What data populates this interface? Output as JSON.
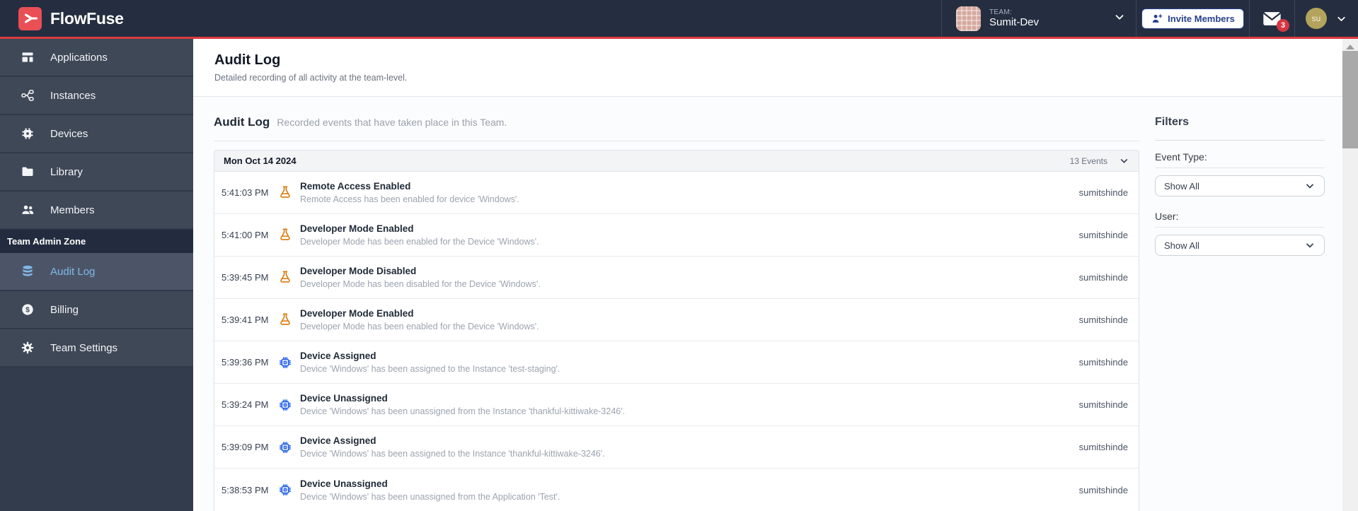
{
  "navbar": {
    "brand": "FlowFuse",
    "team_label": "TEAM:",
    "team_name": "Sumit-Dev",
    "invite_button": "Invite Members",
    "notification_count": "3",
    "avatar_initials": "su",
    "icons": [
      "flowfuse-logo-icon",
      "chevron-down-icon",
      "user-plus-icon",
      "mail-icon"
    ]
  },
  "colors": {
    "accent_red": "#dc3a41",
    "navbar_bg": "#242e40",
    "sidebar_bg": "#3e4857",
    "selected_text": "#7fb9e6",
    "link_blue": "#27408b",
    "flask_orange": "#d97706",
    "chip_blue": "#2563eb"
  },
  "sidebar": {
    "items": [
      {
        "label": "Applications",
        "icon": "template-icon"
      },
      {
        "label": "Instances",
        "icon": "instances-icon"
      },
      {
        "label": "Devices",
        "icon": "chip-icon"
      },
      {
        "label": "Library",
        "icon": "folder-icon"
      },
      {
        "label": "Members",
        "icon": "users-icon"
      }
    ],
    "admin_zone_label": "Team Admin Zone",
    "admin_items": [
      {
        "label": "Audit Log",
        "icon": "database-icon",
        "selected": true
      },
      {
        "label": "Billing",
        "icon": "dollar-icon",
        "selected": false
      },
      {
        "label": "Team Settings",
        "icon": "gear-icon",
        "selected": false
      }
    ]
  },
  "page": {
    "title": "Audit Log",
    "subtitle": "Detailed recording of all activity at the team-level."
  },
  "section": {
    "title": "Audit Log",
    "description": "Recorded events that have taken place in this Team."
  },
  "log": {
    "date": "Mon Oct 14 2024",
    "events_count": "13 Events",
    "rows": [
      {
        "time": "5:41:03 PM",
        "icon": "flask",
        "title": "Remote Access Enabled",
        "description": "Remote Access has been enabled for device 'Windows'.",
        "user": "sumitshinde"
      },
      {
        "time": "5:41:00 PM",
        "icon": "flask",
        "title": "Developer Mode Enabled",
        "description": "Developer Mode has been enabled for the Device 'Windows'.",
        "user": "sumitshinde"
      },
      {
        "time": "5:39:45 PM",
        "icon": "flask",
        "title": "Developer Mode Disabled",
        "description": "Developer Mode has been disabled for the Device 'Windows'.",
        "user": "sumitshinde"
      },
      {
        "time": "5:39:41 PM",
        "icon": "flask",
        "title": "Developer Mode Enabled",
        "description": "Developer Mode has been enabled for the Device 'Windows'.",
        "user": "sumitshinde"
      },
      {
        "time": "5:39:36 PM",
        "icon": "chip",
        "title": "Device Assigned",
        "description": "Device 'Windows' has been assigned to the Instance 'test-staging'.",
        "user": "sumitshinde"
      },
      {
        "time": "5:39:24 PM",
        "icon": "chip",
        "title": "Device Unassigned",
        "description": "Device 'Windows' has been unassigned from the Instance 'thankful-kittiwake-3246'.",
        "user": "sumitshinde"
      },
      {
        "time": "5:39:09 PM",
        "icon": "chip",
        "title": "Device Assigned",
        "description": "Device 'Windows' has been assigned to the Instance 'thankful-kittiwake-3246'.",
        "user": "sumitshinde"
      },
      {
        "time": "5:38:53 PM",
        "icon": "chip",
        "title": "Device Unassigned",
        "description": "Device 'Windows' has been unassigned from the Application 'Test'.",
        "user": "sumitshinde"
      }
    ]
  },
  "filters": {
    "title": "Filters",
    "event_type_label": "Event Type:",
    "event_type_value": "Show All",
    "user_label": "User:",
    "user_value": "Show All"
  }
}
